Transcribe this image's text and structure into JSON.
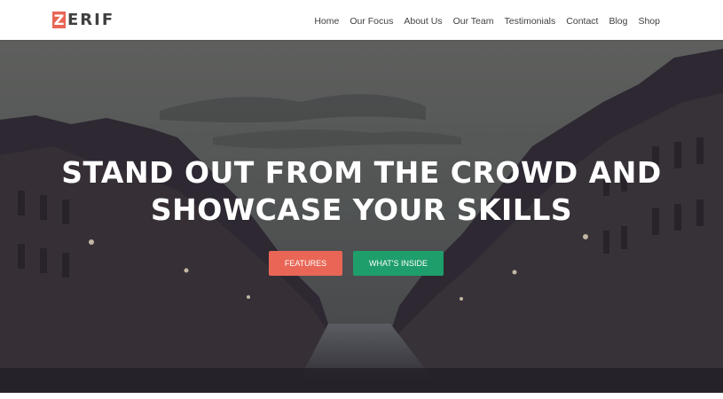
{
  "brand": {
    "initial": "Z",
    "rest": "ERIF",
    "accent_color": "#e96656"
  },
  "nav": {
    "items": [
      {
        "label": "Home"
      },
      {
        "label": "Our Focus"
      },
      {
        "label": "About Us"
      },
      {
        "label": "Our Team"
      },
      {
        "label": "Testimonials"
      },
      {
        "label": "Contact"
      },
      {
        "label": "Blog"
      },
      {
        "label": "Shop"
      }
    ]
  },
  "hero": {
    "title_line1": "STAND OUT FROM THE CROWD AND",
    "title_line2": "SHOWCASE YOUR SKILLS",
    "background_description_icon": "city-canal-photo",
    "buttons": {
      "features_label": "FEATURES",
      "features_color": "#e96656",
      "inside_label": "WHAT'S INSIDE",
      "inside_color": "#1e9e6b"
    }
  }
}
